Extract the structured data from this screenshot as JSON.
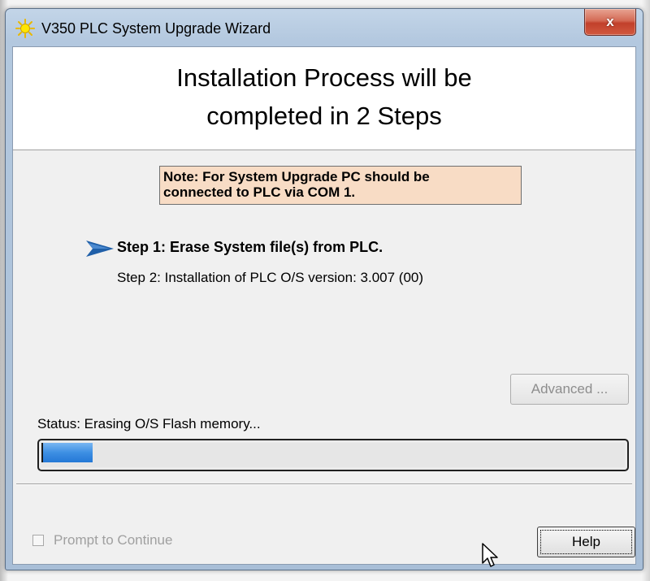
{
  "window": {
    "title": "V350 PLC System Upgrade Wizard",
    "icon": "sun-icon",
    "close_label": "x"
  },
  "header": {
    "line1": "Installation Process will be",
    "line2": "completed in 2 Steps"
  },
  "note": {
    "line1": "Note: For System Upgrade PC should be",
    "line2": "connected to PLC via COM 1."
  },
  "steps": [
    {
      "label": "Step 1: Erase System file(s) from PLC.",
      "current": true
    },
    {
      "label": "Step 2: Installation of PLC O/S version: 3.007 (00)",
      "current": false
    }
  ],
  "advanced_button": {
    "label": "Advanced ...",
    "enabled": false
  },
  "status": {
    "text": "Status: Erasing O/S Flash memory...",
    "progress_fraction": 0.085
  },
  "prompt_checkbox": {
    "label": "Prompt to Continue",
    "checked": false,
    "enabled": false
  },
  "help_button": {
    "label": "Help"
  },
  "colors": {
    "note_background": "#f8dcc5",
    "progress_fill": "#3d8fe3",
    "step_arrow": "#1f5fa8",
    "close_button": "#c1402b"
  }
}
